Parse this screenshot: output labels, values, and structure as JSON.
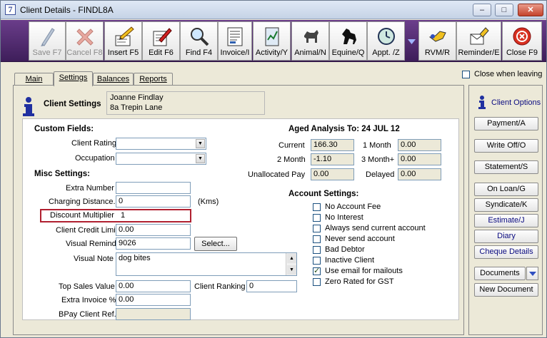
{
  "window": {
    "title": "Client Details - FINDL8A",
    "app_icon": "7",
    "minimize": "–",
    "maximize": "□",
    "close": "✕"
  },
  "toolbar": [
    {
      "name": "save",
      "label": "Save F7",
      "icon": "pen-icon",
      "disabled": true
    },
    {
      "name": "cancel",
      "label": "Cancel F8",
      "icon": "x-icon",
      "disabled": true
    },
    {
      "name": "insert",
      "label": "Insert F5",
      "icon": "pencil-paper-icon",
      "disabled": false
    },
    {
      "name": "edit",
      "label": "Edit F6",
      "icon": "edit-paper-icon",
      "disabled": false
    },
    {
      "name": "find",
      "label": "Find F4",
      "icon": "magnifier-icon",
      "disabled": false
    },
    {
      "name": "invoice",
      "label": "Invoice/I",
      "icon": "invoice-icon",
      "disabled": false
    },
    {
      "name": "activity",
      "label": "Activity/Y",
      "icon": "activity-icon",
      "disabled": false
    },
    {
      "name": "animal",
      "label": "Animal/N",
      "icon": "dog-icon",
      "disabled": false
    },
    {
      "name": "equine",
      "label": "Equine/Q",
      "icon": "horse-icon",
      "disabled": false
    },
    {
      "name": "appt",
      "label": "Appt. /Z",
      "icon": "clock-icon",
      "disabled": false
    },
    {
      "name": "rvm",
      "label": "RVM/R",
      "icon": "rvm-icon",
      "disabled": false
    },
    {
      "name": "reminder",
      "label": "Reminder/E",
      "icon": "reminder-icon",
      "disabled": false
    },
    {
      "name": "close",
      "label": "Close F9",
      "icon": "close-icon",
      "disabled": false
    }
  ],
  "tabs": [
    "Main",
    "Settings",
    "Balances",
    "Reports"
  ],
  "close_when_leaving": "Close when leaving",
  "client_settings": {
    "title": "Client Settings",
    "name": "Joanne Findlay",
    "address": "8a Trepin Lane"
  },
  "custom_fields": {
    "title": "Custom Fields:",
    "client_rating": "Client Rating",
    "occupation": "Occupation"
  },
  "misc": {
    "title": "Misc Settings:",
    "extra_number": {
      "label": "Extra Number",
      "value": ""
    },
    "charging_distance": {
      "label": "Charging Distance.",
      "value": "0",
      "unit": "(Kms)"
    },
    "discount_multiplier": {
      "label": "Discount Multiplier",
      "value": "1"
    },
    "credit_limit": {
      "label": "Client Credit Limit",
      "value": "0.00"
    },
    "visual_reminder": {
      "label": "Visual Reminder",
      "value": "9026",
      "button": "Select..."
    },
    "visual_note": {
      "label": "Visual Note",
      "value": "dog bites"
    },
    "top_sales": {
      "label": "Top Sales Value",
      "value": "0.00"
    },
    "client_ranking": {
      "label": "Client Ranking",
      "value": "0"
    },
    "extra_invoice": {
      "label": "Extra Invoice %",
      "value": "0.00"
    },
    "bpay": {
      "label": "BPay Client Ref.",
      "value": ""
    }
  },
  "aged": {
    "title": "Aged Analysis To: 24 JUL 12",
    "current": {
      "label": "Current",
      "value": "166.30"
    },
    "one_month": {
      "label": "1 Month",
      "value": "0.00"
    },
    "two_month": {
      "label": "2 Month",
      "value": "-1.10"
    },
    "three_month": {
      "label": "3 Month+",
      "value": "0.00"
    },
    "unallocated": {
      "label": "Unallocated Pay",
      "value": "0.00"
    },
    "delayed": {
      "label": "Delayed",
      "value": "0.00"
    }
  },
  "account": {
    "title": "Account Settings:",
    "options": [
      {
        "label": "No Account Fee",
        "checked": false
      },
      {
        "label": "No Interest",
        "checked": false
      },
      {
        "label": "Always send current account",
        "checked": false
      },
      {
        "label": "Never send account",
        "checked": false
      },
      {
        "label": "Bad Debtor",
        "checked": false
      },
      {
        "label": "Inactive Client",
        "checked": false
      },
      {
        "label": "Use email for mailouts",
        "checked": true
      },
      {
        "label": "Zero Rated for GST",
        "checked": false
      }
    ]
  },
  "sidebar": {
    "title": "Client Options",
    "buttons": [
      "Payment/A",
      "Write Off/O",
      "Statement/S",
      "On Loan/G",
      "Syndicate/K",
      "Estimate/J",
      "Diary",
      "Cheque Details",
      "Documents",
      "New Document"
    ]
  }
}
